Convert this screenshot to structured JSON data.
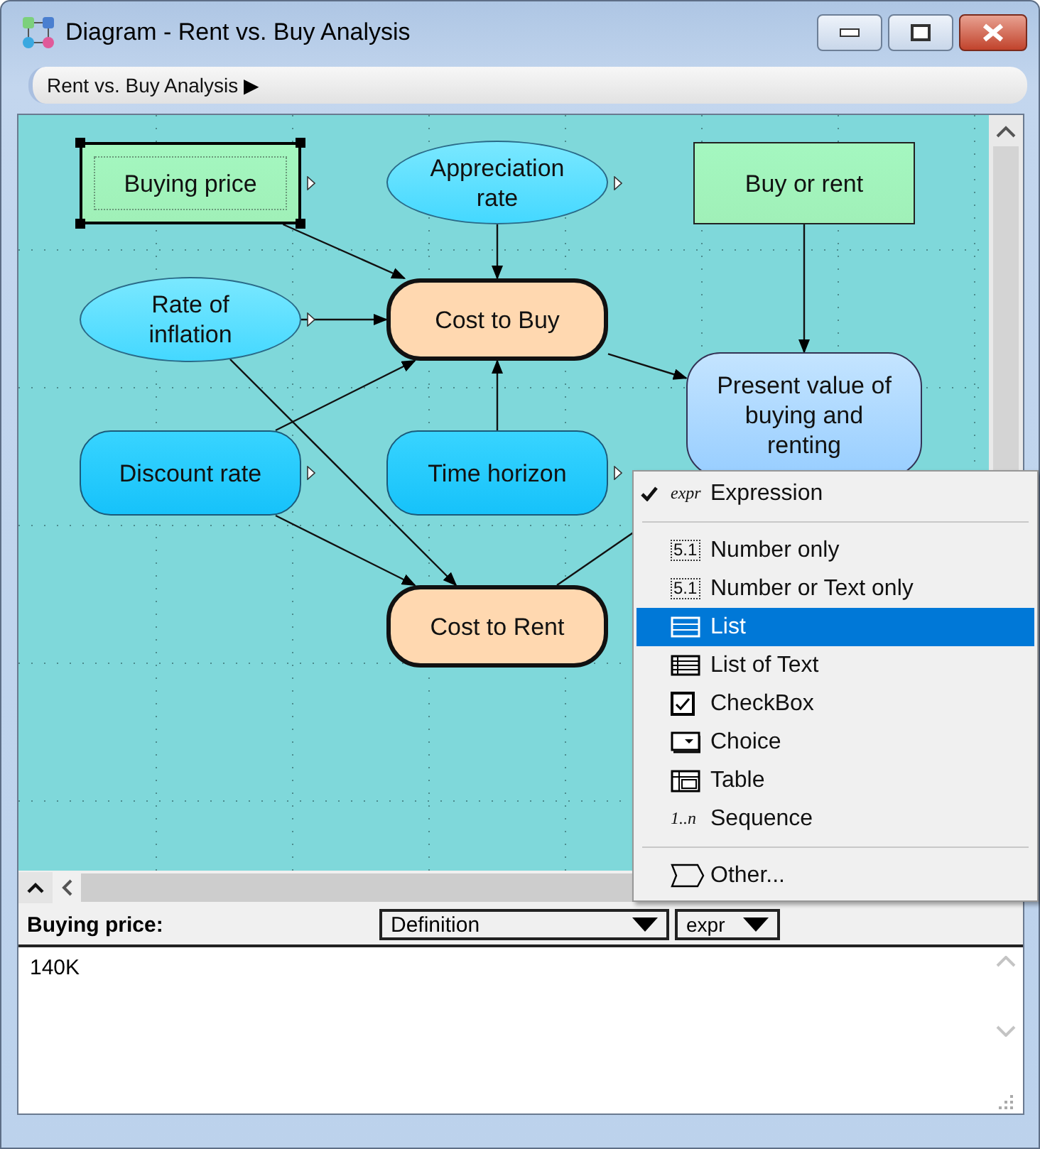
{
  "window": {
    "title": "Diagram - Rent vs. Buy Analysis"
  },
  "breadcrumb": {
    "label": "Rent vs. Buy Analysis",
    "arrow": "▶"
  },
  "diagram": {
    "nodes": [
      {
        "label": "Buying price",
        "kind": "decision",
        "selected": true,
        "output_arrow": true
      },
      {
        "label": "Appreciation rate",
        "kind": "chance",
        "selected": false,
        "output_arrow": true
      },
      {
        "label": "Buy or rent",
        "kind": "decision",
        "selected": false,
        "output_arrow": false
      },
      {
        "label": "Rate of inflation",
        "kind": "chance",
        "selected": false,
        "output_arrow": true
      },
      {
        "label": "Cost to Buy",
        "kind": "variable",
        "selected": false,
        "output_arrow": false
      },
      {
        "label": "Present value of buying and renting",
        "kind": "objective",
        "selected": false,
        "output_arrow": false
      },
      {
        "label": "Discount rate",
        "kind": "constant",
        "selected": false,
        "output_arrow": true
      },
      {
        "label": "Time horizon",
        "kind": "constant",
        "selected": false,
        "output_arrow": true
      },
      {
        "label": "Cost to Rent",
        "kind": "variable",
        "selected": false,
        "output_arrow": false
      }
    ]
  },
  "menu": {
    "items": [
      {
        "kind": "expression",
        "icon_text": "expr",
        "label": "Expression",
        "checked": true,
        "selected": false
      },
      {
        "kind": "separator"
      },
      {
        "kind": "number",
        "icon_text": "5.1",
        "label": "Number only",
        "checked": false,
        "selected": false
      },
      {
        "kind": "number",
        "icon_text": "5.1",
        "label": "Number or Text only",
        "checked": false,
        "selected": false
      },
      {
        "kind": "list",
        "label": "List",
        "checked": false,
        "selected": true
      },
      {
        "kind": "listtext",
        "label": "List of Text",
        "checked": false,
        "selected": false
      },
      {
        "kind": "checkbox",
        "label": "CheckBox",
        "checked": false,
        "selected": false
      },
      {
        "kind": "choice",
        "label": "Choice",
        "checked": false,
        "selected": false
      },
      {
        "kind": "table",
        "label": "Table",
        "checked": false,
        "selected": false
      },
      {
        "kind": "sequence",
        "icon_text": "1..n",
        "label": "Sequence",
        "checked": false,
        "selected": false
      },
      {
        "kind": "separator"
      },
      {
        "kind": "other",
        "label": "Other...",
        "checked": false,
        "selected": false
      }
    ]
  },
  "attribute_panel": {
    "object_label": "Buying price:",
    "attribute": "Definition",
    "type": "expr",
    "value": "140K"
  }
}
